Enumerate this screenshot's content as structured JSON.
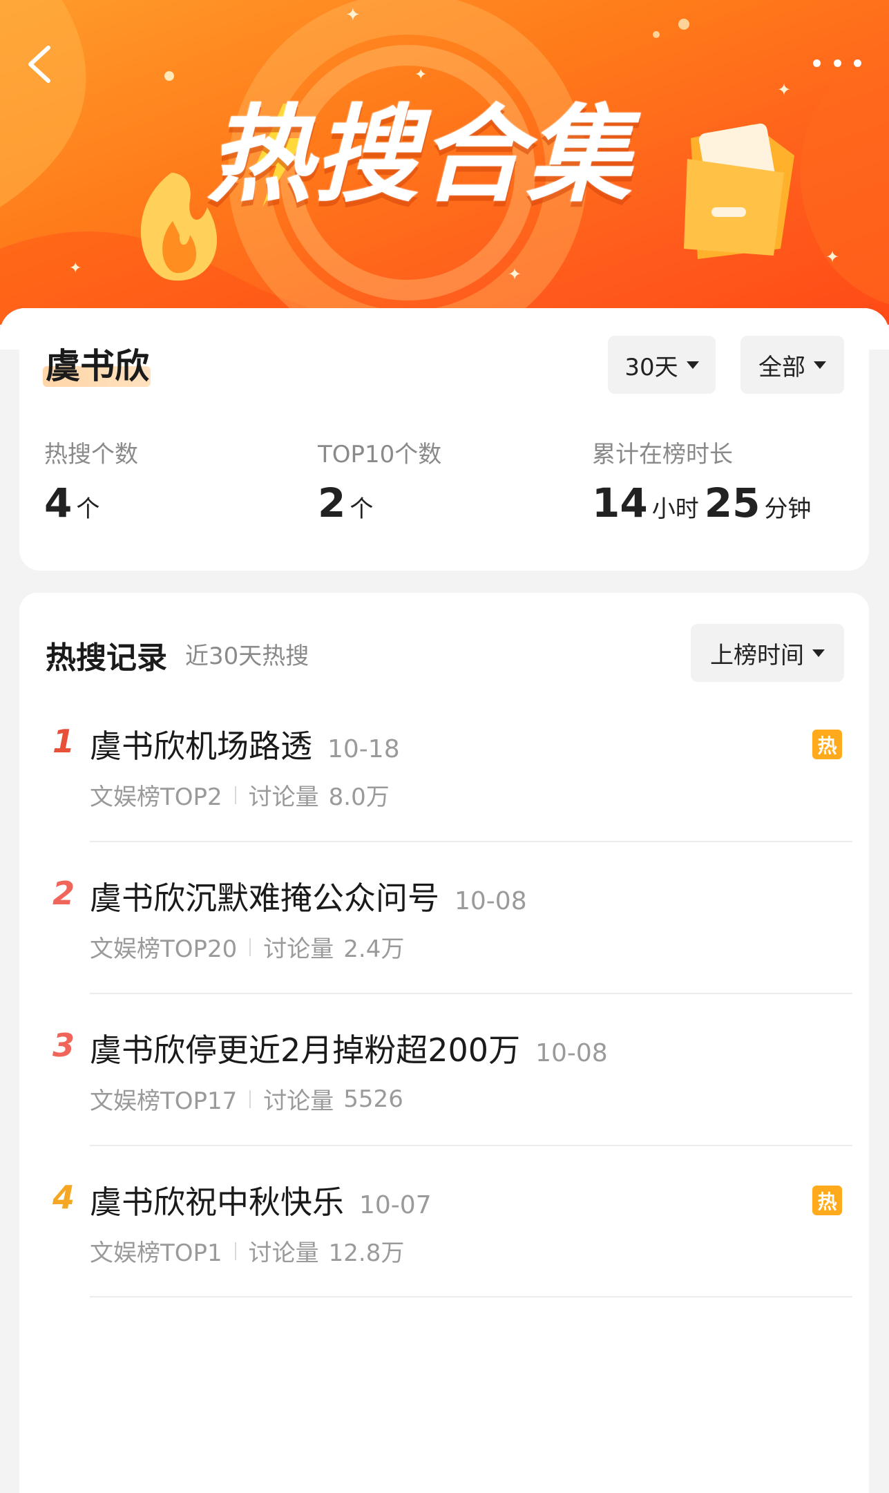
{
  "banner": {
    "title": "热搜合集",
    "colors": {
      "from": "#ff9b2a",
      "to": "#ff4a16"
    }
  },
  "header": {
    "back_icon": "chevron-left-icon",
    "more_icon": "ellipsis-icon"
  },
  "summary": {
    "name": "虞书欣",
    "filters": [
      {
        "label": "30天"
      },
      {
        "label": "全部"
      }
    ],
    "stats": [
      {
        "label": "热搜个数",
        "value": "4",
        "unit": "个"
      },
      {
        "label": "TOP10个数",
        "value": "2",
        "unit": "个"
      },
      {
        "label": "累计在榜时长",
        "hours": "14",
        "hours_unit": "小时",
        "minutes": "25",
        "minutes_unit": "分钟"
      }
    ]
  },
  "records": {
    "title": "热搜记录",
    "subtitle": "近30天热搜",
    "sort_label": "上榜时间",
    "discuss_label": "讨论量",
    "items": [
      {
        "rank": "1",
        "rank_color": "#e8503a",
        "title": "虞书欣机场路透",
        "date": "10-18",
        "board": "文娱榜TOP2",
        "discuss": "8.0万",
        "badge": "热"
      },
      {
        "rank": "2",
        "rank_color": "#f0645a",
        "title": "虞书欣沉默难掩公众问号",
        "date": "10-08",
        "board": "文娱榜TOP20",
        "discuss": "2.4万",
        "badge": ""
      },
      {
        "rank": "3",
        "rank_color": "#f0645a",
        "title": "虞书欣停更近2月掉粉超200万",
        "date": "10-08",
        "board": "文娱榜TOP17",
        "discuss": "5526",
        "badge": ""
      },
      {
        "rank": "4",
        "rank_color": "#f5a623",
        "title": "虞书欣祝中秋快乐",
        "date": "10-07",
        "board": "文娱榜TOP1",
        "discuss": "12.8万",
        "badge": "热"
      }
    ]
  }
}
